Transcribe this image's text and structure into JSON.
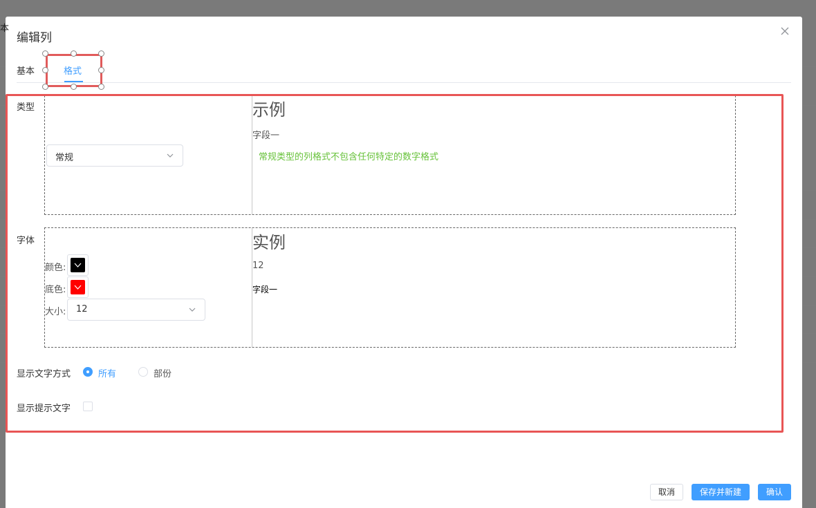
{
  "background": {
    "partial_text": "本"
  },
  "dialog": {
    "title": "编辑列",
    "close_icon": "close-icon"
  },
  "tabs": [
    {
      "label": "基本",
      "active": false
    },
    {
      "label": "格式",
      "active": true
    }
  ],
  "type_section": {
    "label": "类型",
    "select_value": "常规",
    "sample_title": "示例",
    "sample_field": "字段一",
    "description": "常规类型的列格式不包含任何特定的数字格式"
  },
  "font_section": {
    "label": "字体",
    "color_label": "颜色:",
    "color_value": "#000000",
    "bg_label": "底色:",
    "bg_value": "#ff0000",
    "size_label": "大小:",
    "size_value": "12",
    "sample_title": "实例",
    "sample_size": "12",
    "sample_field": "字段一"
  },
  "display_mode": {
    "label": "显示文字方式",
    "options": [
      {
        "label": "所有",
        "checked": true
      },
      {
        "label": "部份",
        "checked": false
      }
    ]
  },
  "tooltip": {
    "label": "显示提示文字",
    "checked": false
  },
  "footer": {
    "cancel": "取消",
    "save_new": "保存并新建",
    "confirm": "确认"
  },
  "colors": {
    "primary": "#409eff",
    "success": "#67c23a",
    "highlight": "#e85555"
  }
}
